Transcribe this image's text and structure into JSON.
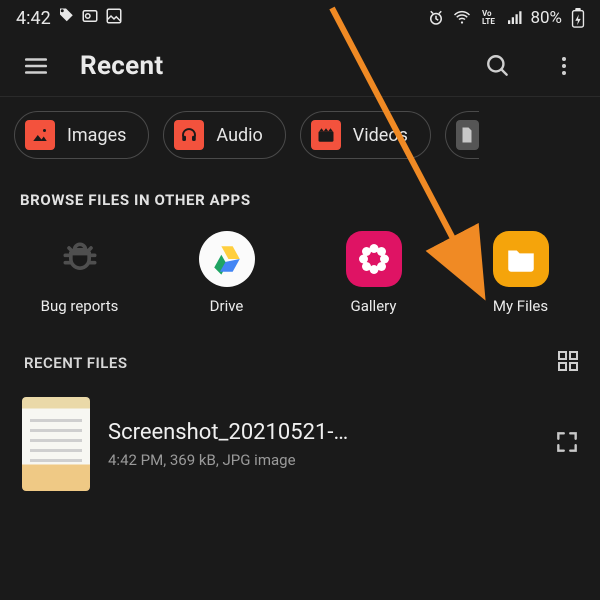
{
  "status": {
    "time": "4:42",
    "battery": "80%"
  },
  "appbar": {
    "title": "Recent"
  },
  "chips": {
    "images": "Images",
    "audio": "Audio",
    "videos": "Videos"
  },
  "sections": {
    "browse_apps": "BROWSE FILES IN OTHER APPS",
    "recent_files": "RECENT FILES"
  },
  "apps": {
    "bug": "Bug reports",
    "drive": "Drive",
    "gallery": "Gallery",
    "myfiles": "My Files"
  },
  "file": {
    "name": "Screenshot_20210521-…",
    "sub": "4:42 PM, 369 kB, JPG image"
  }
}
